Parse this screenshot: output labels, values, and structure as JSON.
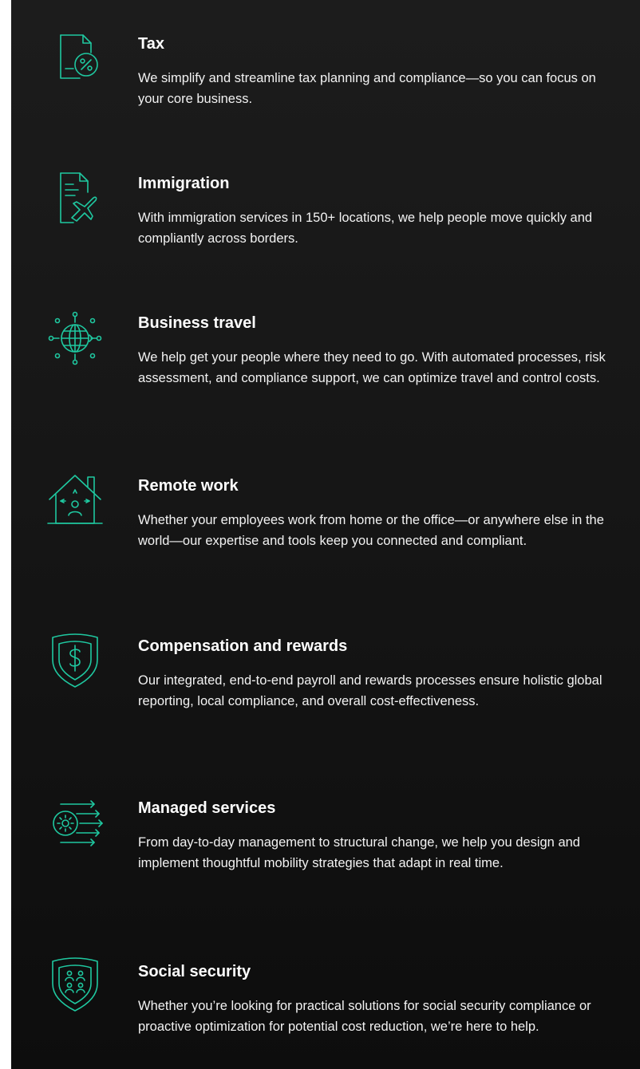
{
  "theme": {
    "background": "#161616",
    "accent": "#1fc8a0",
    "text": "#ffffff"
  },
  "services": [
    {
      "icon": "tax-document-percent-icon",
      "title": "Tax",
      "description": "We simplify and streamline tax planning and compliance—so you can focus on your core business."
    },
    {
      "icon": "immigration-document-plane-icon",
      "title": "Immigration",
      "description": "With immigration services in 150+ locations, we help people move quickly and compliantly across borders."
    },
    {
      "icon": "globe-network-icon",
      "title": "Business travel",
      "description": "We help get your people where they need to go. With automated processes, risk assessment, and compliance support, we can optimize travel and control costs."
    },
    {
      "icon": "house-person-icon",
      "title": "Remote work",
      "description": "Whether your employees work from home or the office—or anywhere else in the world—our expertise and tools keep you connected and compliant."
    },
    {
      "icon": "shield-dollar-icon",
      "title": "Compensation and rewards",
      "description": "Our integrated, end-to-end payroll and rewards processes ensure holistic global reporting, local compliance, and overall cost-effectiveness."
    },
    {
      "icon": "gear-arrows-icon",
      "title": "Managed services",
      "description": "From day-to-day management to structural change, we help you design and implement thoughtful mobility strategies that adapt in real time."
    },
    {
      "icon": "shield-people-icon",
      "title": "Social security",
      "description": "Whether you’re looking for practical solutions for social security compliance or proactive optimization for potential cost reduction, we’re here to help."
    }
  ]
}
